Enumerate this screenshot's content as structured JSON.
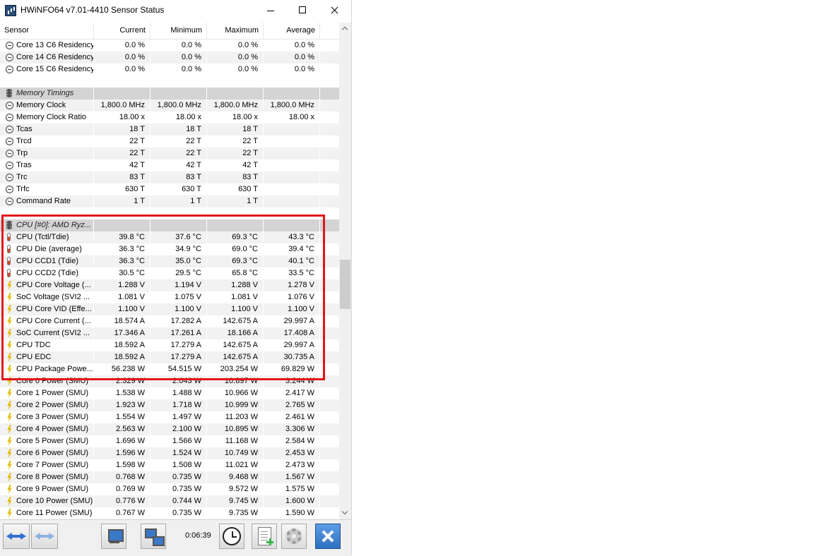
{
  "window": {
    "title": "HWiNFO64 v7.01-4410 Sensor Status"
  },
  "columns": [
    "Sensor",
    "Current",
    "Minimum",
    "Maximum",
    "Average"
  ],
  "rows": [
    {
      "type": "data",
      "icon": "clock",
      "name": "Core 13 C6 Residency",
      "cur": "0.0 %",
      "min": "0.0 %",
      "max": "0.0 %",
      "avg": "0.0 %"
    },
    {
      "type": "data",
      "icon": "clock",
      "name": "Core 14 C6 Residency",
      "cur": "0.0 %",
      "min": "0.0 %",
      "max": "0.0 %",
      "avg": "0.0 %"
    },
    {
      "type": "data",
      "icon": "clock",
      "name": "Core 15 C6 Residency",
      "cur": "0.0 %",
      "min": "0.0 %",
      "max": "0.0 %",
      "avg": "0.0 %"
    },
    {
      "type": "blank"
    },
    {
      "type": "group",
      "icon": "chip",
      "name": "Memory Timings"
    },
    {
      "type": "data",
      "icon": "clock",
      "name": "Memory Clock",
      "cur": "1,800.0 MHz",
      "min": "1,800.0 MHz",
      "max": "1,800.0 MHz",
      "avg": "1,800.0 MHz"
    },
    {
      "type": "data",
      "icon": "clock",
      "name": "Memory Clock Ratio",
      "cur": "18.00 x",
      "min": "18.00 x",
      "max": "18.00 x",
      "avg": "18.00 x"
    },
    {
      "type": "data",
      "icon": "clock",
      "name": "Tcas",
      "cur": "18 T",
      "min": "18 T",
      "max": "18 T",
      "avg": ""
    },
    {
      "type": "data",
      "icon": "clock",
      "name": "Trcd",
      "cur": "22 T",
      "min": "22 T",
      "max": "22 T",
      "avg": ""
    },
    {
      "type": "data",
      "icon": "clock",
      "name": "Trp",
      "cur": "22 T",
      "min": "22 T",
      "max": "22 T",
      "avg": ""
    },
    {
      "type": "data",
      "icon": "clock",
      "name": "Tras",
      "cur": "42 T",
      "min": "42 T",
      "max": "42 T",
      "avg": ""
    },
    {
      "type": "data",
      "icon": "clock",
      "name": "Trc",
      "cur": "83 T",
      "min": "83 T",
      "max": "83 T",
      "avg": ""
    },
    {
      "type": "data",
      "icon": "clock",
      "name": "Trfc",
      "cur": "630 T",
      "min": "630 T",
      "max": "630 T",
      "avg": ""
    },
    {
      "type": "data",
      "icon": "clock",
      "name": "Command Rate",
      "cur": "1 T",
      "min": "1 T",
      "max": "1 T",
      "avg": ""
    },
    {
      "type": "blank"
    },
    {
      "type": "group",
      "icon": "chip",
      "name": "CPU [#0]: AMD Ryz..."
    },
    {
      "type": "data",
      "icon": "therm",
      "name": "CPU (Tctl/Tdie)",
      "cur": "39.8 °C",
      "min": "37.6 °C",
      "max": "69.3 °C",
      "avg": "43.3 °C"
    },
    {
      "type": "data",
      "icon": "therm",
      "name": "CPU Die (average)",
      "cur": "36.3 °C",
      "min": "34.9 °C",
      "max": "69.0 °C",
      "avg": "39.4 °C"
    },
    {
      "type": "data",
      "icon": "therm",
      "name": "CPU CCD1 (Tdie)",
      "cur": "36.3 °C",
      "min": "35.0 °C",
      "max": "69.3 °C",
      "avg": "40.1 °C"
    },
    {
      "type": "data",
      "icon": "therm",
      "name": "CPU CCD2 (Tdie)",
      "cur": "30.5 °C",
      "min": "29.5 °C",
      "max": "65.8 °C",
      "avg": "33.5 °C"
    },
    {
      "type": "data",
      "icon": "bolt",
      "name": "CPU Core Voltage (...",
      "cur": "1.288 V",
      "min": "1.194 V",
      "max": "1.288 V",
      "avg": "1.278 V"
    },
    {
      "type": "data",
      "icon": "bolt",
      "name": "SoC Voltage (SVI2 ...",
      "cur": "1.081 V",
      "min": "1.075 V",
      "max": "1.081 V",
      "avg": "1.076 V"
    },
    {
      "type": "data",
      "icon": "bolt",
      "name": "CPU Core VID (Effe...",
      "cur": "1.100 V",
      "min": "1.100 V",
      "max": "1.100 V",
      "avg": "1.100 V"
    },
    {
      "type": "data",
      "icon": "bolt",
      "name": "CPU Core Current (...",
      "cur": "18.574 A",
      "min": "17.282 A",
      "max": "142.675 A",
      "avg": "29.997 A"
    },
    {
      "type": "data",
      "icon": "bolt",
      "name": "SoC Current (SVI2 ...",
      "cur": "17.346 A",
      "min": "17.261 A",
      "max": "18.166 A",
      "avg": "17.408 A"
    },
    {
      "type": "data",
      "icon": "bolt",
      "name": "CPU TDC",
      "cur": "18.592 A",
      "min": "17.279 A",
      "max": "142.675 A",
      "avg": "29.997 A"
    },
    {
      "type": "data",
      "icon": "bolt",
      "name": "CPU EDC",
      "cur": "18.592 A",
      "min": "17.279 A",
      "max": "142.675 A",
      "avg": "30.735 A"
    },
    {
      "type": "data",
      "icon": "bolt",
      "name": "CPU Package Powe...",
      "cur": "56.238 W",
      "min": "54.515 W",
      "max": "203.254 W",
      "avg": "69.829 W"
    },
    {
      "type": "data",
      "icon": "bolt",
      "name": "Core 0 Power (SMU)",
      "cur": "2.329 W",
      "min": "2.043 W",
      "max": "10.897 W",
      "avg": "3.244 W"
    },
    {
      "type": "data",
      "icon": "bolt",
      "name": "Core 1 Power (SMU)",
      "cur": "1.538 W",
      "min": "1.488 W",
      "max": "10.966 W",
      "avg": "2.417 W"
    },
    {
      "type": "data",
      "icon": "bolt",
      "name": "Core 2 Power (SMU)",
      "cur": "1.923 W",
      "min": "1.718 W",
      "max": "10.999 W",
      "avg": "2.765 W"
    },
    {
      "type": "data",
      "icon": "bolt",
      "name": "Core 3 Power (SMU)",
      "cur": "1.554 W",
      "min": "1.497 W",
      "max": "11.203 W",
      "avg": "2.461 W"
    },
    {
      "type": "data",
      "icon": "bolt",
      "name": "Core 4 Power (SMU)",
      "cur": "2.563 W",
      "min": "2.100 W",
      "max": "10.895 W",
      "avg": "3.306 W"
    },
    {
      "type": "data",
      "icon": "bolt",
      "name": "Core 5 Power (SMU)",
      "cur": "1.696 W",
      "min": "1.566 W",
      "max": "11.168 W",
      "avg": "2.584 W"
    },
    {
      "type": "data",
      "icon": "bolt",
      "name": "Core 6 Power (SMU)",
      "cur": "1.596 W",
      "min": "1.524 W",
      "max": "10.749 W",
      "avg": "2.453 W"
    },
    {
      "type": "data",
      "icon": "bolt",
      "name": "Core 7 Power (SMU)",
      "cur": "1.598 W",
      "min": "1.508 W",
      "max": "11.021 W",
      "avg": "2.473 W"
    },
    {
      "type": "data",
      "icon": "bolt",
      "name": "Core 8 Power (SMU)",
      "cur": "0.768 W",
      "min": "0.735 W",
      "max": "9.468 W",
      "avg": "1.567 W"
    },
    {
      "type": "data",
      "icon": "bolt",
      "name": "Core 9 Power (SMU)",
      "cur": "0.769 W",
      "min": "0.735 W",
      "max": "9.572 W",
      "avg": "1.575 W"
    },
    {
      "type": "data",
      "icon": "bolt",
      "name": "Core 10 Power (SMU)",
      "cur": "0.776 W",
      "min": "0.744 W",
      "max": "9.745 W",
      "avg": "1.600 W"
    },
    {
      "type": "data",
      "icon": "bolt",
      "name": "Core 11 Power (SMU)",
      "cur": "0.767 W",
      "min": "0.735 W",
      "max": "9.735 W",
      "avg": "1.590 W"
    }
  ],
  "toolbar": {
    "elapsed": "0:06:39",
    "icons": [
      "navigate-arrows-icon",
      "navigate-arrows-disabled-icon",
      "monitor-icon",
      "network-icon",
      "clock-icon",
      "report-add-icon",
      "gear-icon",
      "close-x-icon"
    ]
  },
  "colors": {
    "highlight_border": "#e0141c",
    "group_row": "#d4d4d4",
    "alt_row": "#f2f2f2",
    "close_button": "#2d6fc0"
  }
}
